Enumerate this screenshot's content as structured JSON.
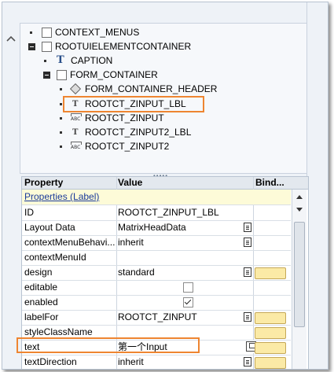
{
  "tree": {
    "nodes": [
      {
        "label": "CONTEXT_MENUS",
        "icon": "folder-icon"
      },
      {
        "label": "ROOTUIELEMENTCONTAINER",
        "icon": "folder-icon"
      },
      {
        "label": "CAPTION",
        "icon": "text-view-icon"
      },
      {
        "label": "FORM_CONTAINER",
        "icon": "folder-icon"
      },
      {
        "label": "FORM_CONTAINER_HEADER",
        "icon": "diamond-icon"
      },
      {
        "label": "ROOTCT_ZINPUT_LBL",
        "icon": "label-icon",
        "selected": true
      },
      {
        "label": "ROOTCT_ZINPUT",
        "icon": "input-field-icon"
      },
      {
        "label": "ROOTCT_ZINPUT2_LBL",
        "icon": "label-icon"
      },
      {
        "label": "ROOTCT_ZINPUT2",
        "icon": "input-field-icon"
      }
    ]
  },
  "grid": {
    "headers": {
      "property": "Property",
      "value": "Value",
      "binding": "Bind..."
    },
    "section": "Properties (Label)",
    "rows": [
      {
        "name": "ID",
        "value": "ROOTCT_ZINPUT_LBL"
      },
      {
        "name": "Layout Data",
        "value": "MatrixHeadData"
      },
      {
        "name": "contextMenuBehavi...",
        "value": "inherit"
      },
      {
        "name": "contextMenuId",
        "value": ""
      },
      {
        "name": "design",
        "value": "standard"
      },
      {
        "name": "editable",
        "value": "",
        "checkbox": false
      },
      {
        "name": "enabled",
        "value": "",
        "checkbox": true
      },
      {
        "name": "labelFor",
        "value": "ROOTCT_ZINPUT"
      },
      {
        "name": "styleClassName",
        "value": ""
      },
      {
        "name": "text",
        "value": "第一个Input",
        "highlighted": true
      },
      {
        "name": "textDirection",
        "value": "inherit"
      }
    ]
  },
  "colors": {
    "accent_highlight": "#ee8531",
    "section_bg": "#fdfbd8",
    "bind_button": "#fbeaa6"
  }
}
